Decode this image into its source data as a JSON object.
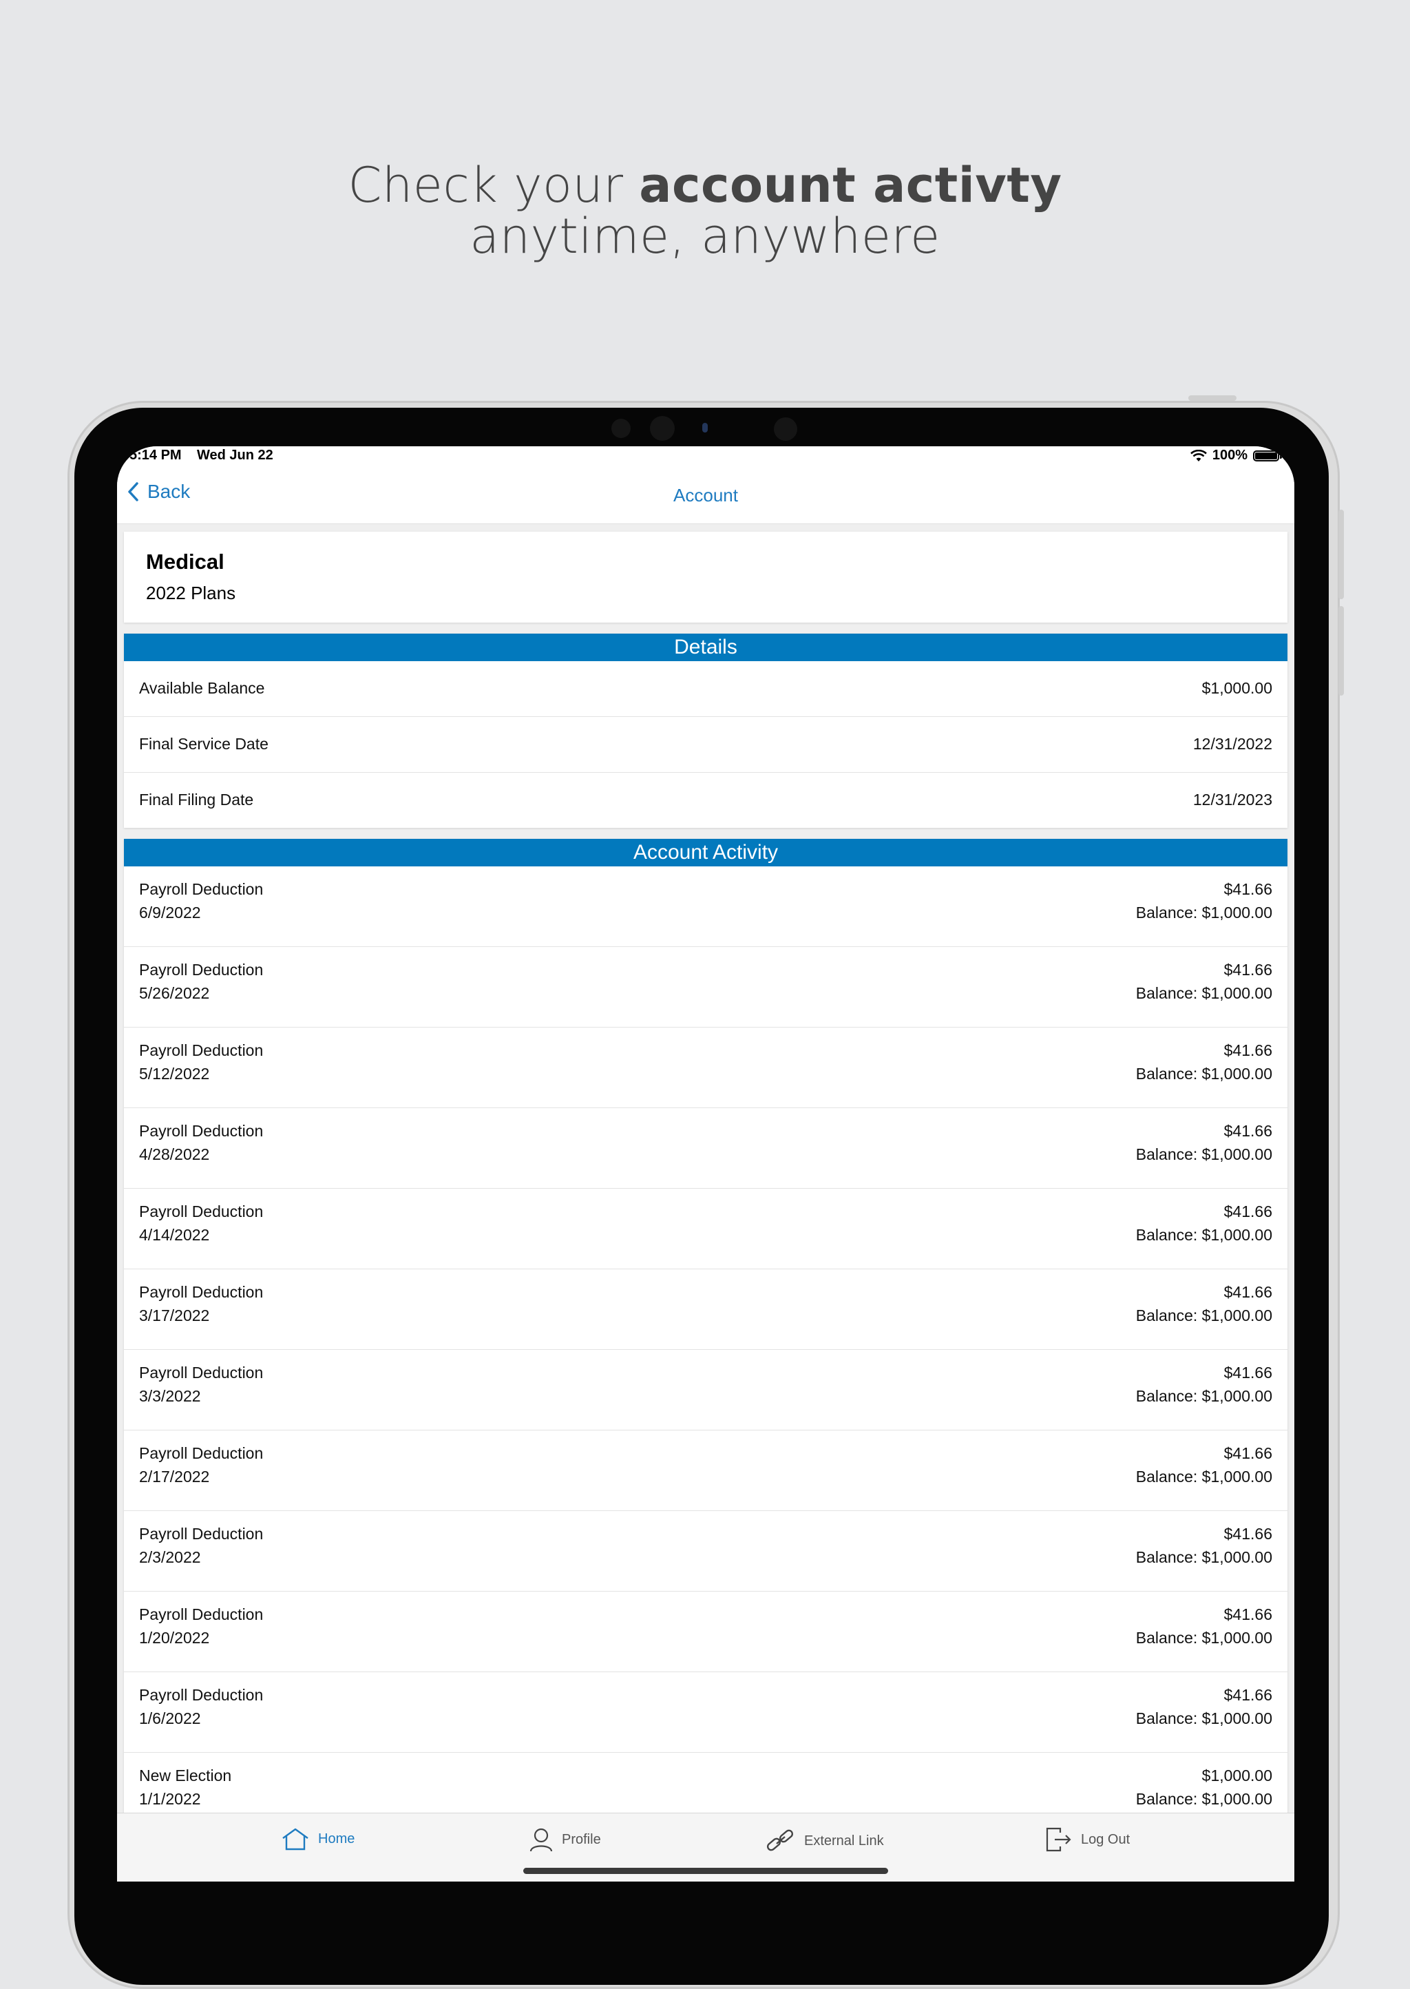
{
  "headline": {
    "line1_regular": "Check your ",
    "line1_bold": "account activty",
    "line2": "anytime, anywhere"
  },
  "status_bar": {
    "time": "5:14 PM",
    "date": "Wed Jun 22",
    "battery": "100%",
    "battery_level": 1.0
  },
  "nav": {
    "back_label": "Back",
    "title": "Account"
  },
  "plan": {
    "title": "Medical",
    "subtitle": "2022 Plans"
  },
  "details": {
    "header": "Details",
    "rows": [
      {
        "label": "Available Balance",
        "value": "$1,000.00"
      },
      {
        "label": "Final Service Date",
        "value": "12/31/2022"
      },
      {
        "label": "Final Filing Date",
        "value": "12/31/2023"
      }
    ]
  },
  "activity": {
    "header": "Account Activity",
    "rows": [
      {
        "type": "Payroll Deduction",
        "date": "6/9/2022",
        "amount": "$41.66",
        "balance": "Balance: $1,000.00"
      },
      {
        "type": "Payroll Deduction",
        "date": "5/26/2022",
        "amount": "$41.66",
        "balance": "Balance: $1,000.00"
      },
      {
        "type": "Payroll Deduction",
        "date": "5/12/2022",
        "amount": "$41.66",
        "balance": "Balance: $1,000.00"
      },
      {
        "type": "Payroll Deduction",
        "date": "4/28/2022",
        "amount": "$41.66",
        "balance": "Balance: $1,000.00"
      },
      {
        "type": "Payroll Deduction",
        "date": "4/14/2022",
        "amount": "$41.66",
        "balance": "Balance: $1,000.00"
      },
      {
        "type": "Payroll Deduction",
        "date": "3/17/2022",
        "amount": "$41.66",
        "balance": "Balance: $1,000.00"
      },
      {
        "type": "Payroll Deduction",
        "date": "3/3/2022",
        "amount": "$41.66",
        "balance": "Balance: $1,000.00"
      },
      {
        "type": "Payroll Deduction",
        "date": "2/17/2022",
        "amount": "$41.66",
        "balance": "Balance: $1,000.00"
      },
      {
        "type": "Payroll Deduction",
        "date": "2/3/2022",
        "amount": "$41.66",
        "balance": "Balance: $1,000.00"
      },
      {
        "type": "Payroll Deduction",
        "date": "1/20/2022",
        "amount": "$41.66",
        "balance": "Balance: $1,000.00"
      },
      {
        "type": "Payroll Deduction",
        "date": "1/6/2022",
        "amount": "$41.66",
        "balance": "Balance: $1,000.00"
      },
      {
        "type": "New Election",
        "date": "1/1/2022",
        "amount": "$1,000.00",
        "balance": "Balance: $1,000.00"
      }
    ]
  },
  "tabs": {
    "home": "Home",
    "profile": "Profile",
    "external": "External Link",
    "logout": "Log Out"
  },
  "colors": {
    "accent": "#1e7bc0",
    "section_header": "#0279bd",
    "background": "#e6e7e9"
  },
  "icons": {
    "back": "chevron-left-icon",
    "wifi": "wifi-icon",
    "battery": "battery-icon",
    "home": "home-icon",
    "profile": "user-icon",
    "external": "link-icon",
    "logout": "logout-icon"
  }
}
